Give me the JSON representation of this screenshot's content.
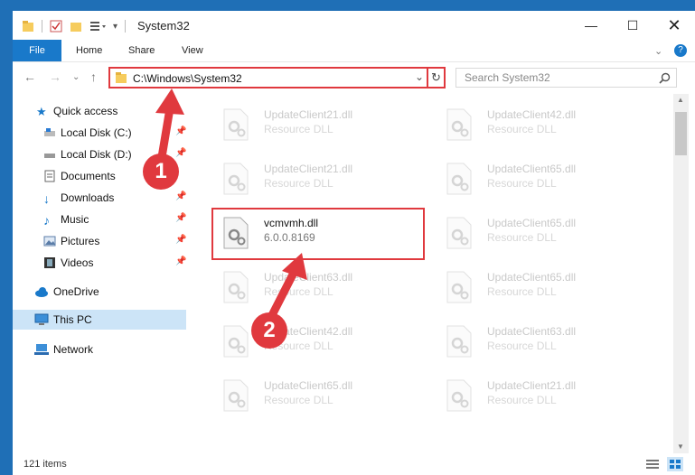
{
  "window": {
    "title": "System32"
  },
  "ribbon": {
    "tabs": [
      "File",
      "Home",
      "Share",
      "View"
    ]
  },
  "navbar": {
    "address": "C:\\Windows\\System32",
    "search_placeholder": "Search System32"
  },
  "nav": {
    "items": [
      {
        "label": "Quick access",
        "icon": "star-icon",
        "pinned": false
      },
      {
        "label": "Local Disk (C:)",
        "icon": "disk-icon",
        "pinned": true
      },
      {
        "label": "Local Disk (D:)",
        "icon": "disk-icon",
        "pinned": true
      },
      {
        "label": "Documents",
        "icon": "documents-icon",
        "pinned": true
      },
      {
        "label": "Downloads",
        "icon": "download-icon",
        "pinned": true
      },
      {
        "label": "Music",
        "icon": "music-icon",
        "pinned": true
      },
      {
        "label": "Pictures",
        "icon": "pictures-icon",
        "pinned": true
      },
      {
        "label": "Videos",
        "icon": "videos-icon",
        "pinned": true
      },
      {
        "label": "OneDrive",
        "icon": "cloud-icon",
        "pinned": false
      },
      {
        "label": "This PC",
        "icon": "pc-icon",
        "pinned": false,
        "selected": true
      },
      {
        "label": "Network",
        "icon": "network-icon",
        "pinned": false
      }
    ]
  },
  "files": {
    "tiles": [
      {
        "name": "UpdateClient21.dll",
        "desc": "Resource DLL"
      },
      {
        "name": "UpdateClient42.dll",
        "desc": "Resource DLL"
      },
      {
        "name": "UpdateClient21.dll",
        "desc": "Resource DLL"
      },
      {
        "name": "UpdateClient65.dll",
        "desc": "Resource DLL"
      },
      {
        "name": "vcmvmh.dll",
        "desc": "6.0.0.8169",
        "selected": true
      },
      {
        "name": "UpdateClient65.dll",
        "desc": "Resource DLL"
      },
      {
        "name": "UpdateClient63.dll",
        "desc": "Resource DLL"
      },
      {
        "name": "UpdateClient65.dll",
        "desc": "Resource DLL"
      },
      {
        "name": "UpdateClient42.dll",
        "desc": "Resource DLL"
      },
      {
        "name": "UpdateClient63.dll",
        "desc": "Resource DLL"
      },
      {
        "name": "UpdateClient65.dll",
        "desc": "Resource DLL"
      },
      {
        "name": "UpdateClient21.dll",
        "desc": "Resource DLL"
      }
    ]
  },
  "status": {
    "item_count": "121 items"
  },
  "annotations": {
    "step1": "1",
    "step2": "2",
    "color": "#e0393e"
  }
}
